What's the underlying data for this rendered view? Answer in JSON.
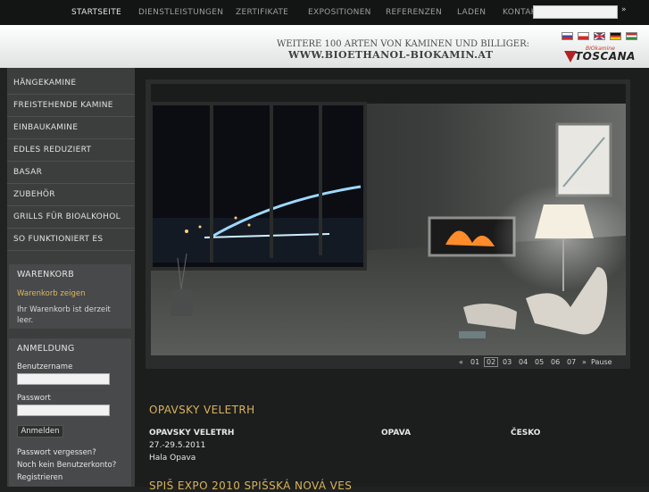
{
  "nav": {
    "items": [
      "STARTSEITE",
      "DIENSTLEISTUNGEN",
      "ZERTIFIKATE",
      "EXPOSITIONEN",
      "REFERENZEN",
      "LADEN",
      "KONTAKT"
    ],
    "search_button": "»"
  },
  "header": {
    "tagline": "WEITERE 100 ARTEN VON KAMINEN UND BILLIGER:",
    "url": "WWW.BIOETHANOL-BIOKAMIN.AT",
    "logo_small": "BIOkamine",
    "logo_name": "TOSCANA"
  },
  "sidebar": {
    "items": [
      "HÄNGEKAMINE",
      "FREISTEHENDE KAMINE",
      "EINBAUKAMINE",
      "EDLES REDUZIERT",
      "BASAR",
      "ZUBEHÖR",
      "GRILLS FÜR BIOALKOHOL",
      "SO FUNKTIONIERT ES"
    ]
  },
  "cart": {
    "title": "WARENKORB",
    "link": "Warenkorb zeigen",
    "text": "Ihr Warenkorb ist derzeit leer."
  },
  "login": {
    "title": "ANMELDUNG",
    "username_label": "Benutzername",
    "password_label": "Passwort",
    "button": "Anmelden",
    "forgot": "Passwort vergessen?",
    "no_account": "Noch kein Benutzerkonto?",
    "register": "Registrieren"
  },
  "slider": {
    "prev": "«",
    "pages": [
      "01",
      "02",
      "03",
      "04",
      "05",
      "06",
      "07"
    ],
    "current": "02",
    "next": "»",
    "pause": "Pause"
  },
  "events": [
    {
      "heading": "OPAVSKY VELETRH",
      "name": "OPAVSKY VELETRH",
      "date": "27.-29.5.2011",
      "place": "Hala Opava",
      "city": "OPAVA",
      "country": "ČESKO"
    },
    {
      "heading": "SPIŠ EXPO 2010 SPIŠSKÁ NOVÁ VES"
    }
  ]
}
